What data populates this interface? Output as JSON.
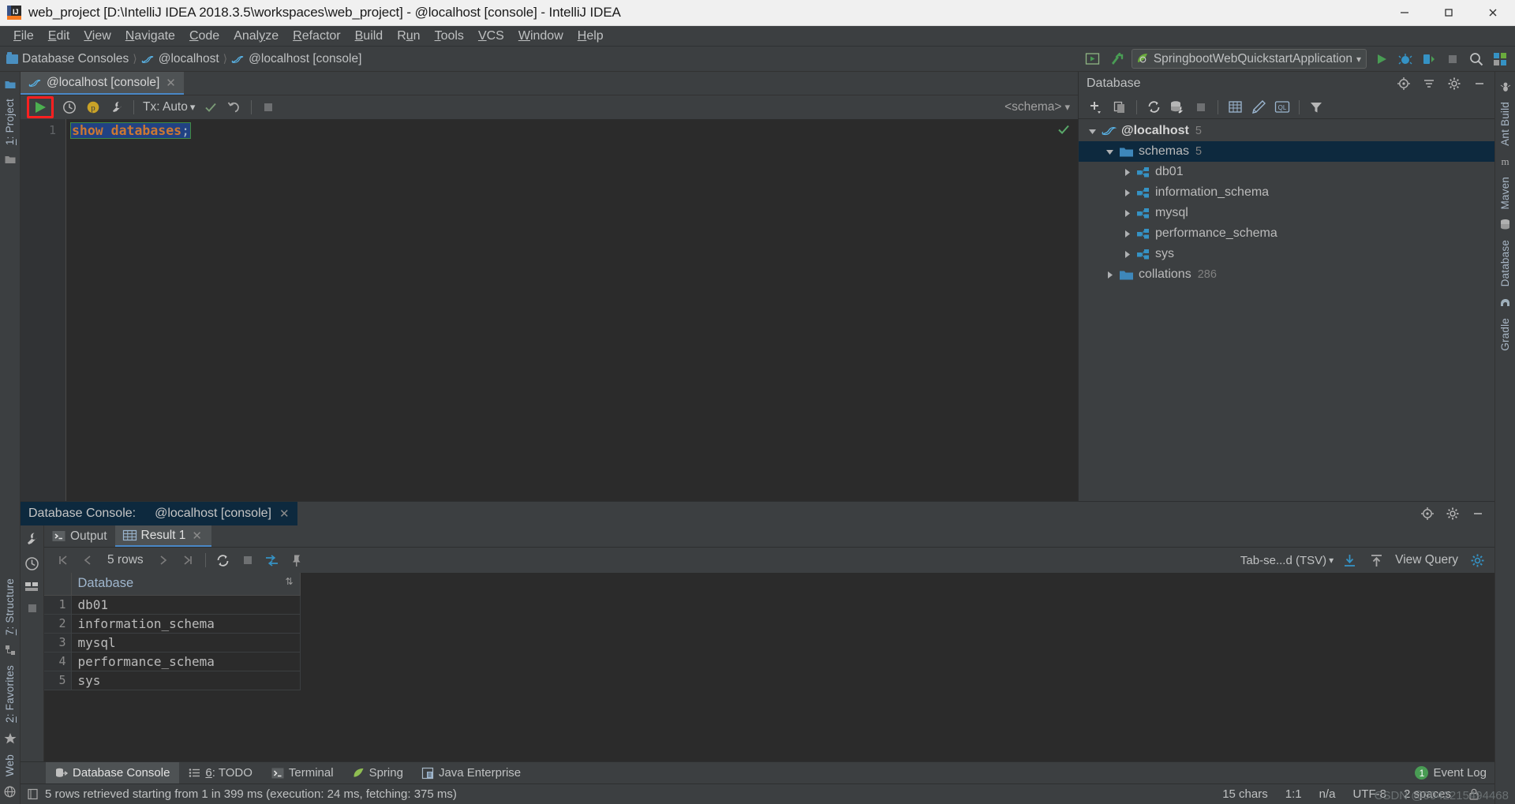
{
  "window": {
    "title": "web_project [D:\\IntelliJ IDEA 2018.3.5\\workspaces\\web_project] - @localhost [console] - IntelliJ IDEA",
    "app_icon": "intellij-idea-icon",
    "minimize_glyph": "—",
    "maximize_glyph": "❐",
    "close_glyph": "✕"
  },
  "menubar": {
    "items": [
      {
        "label": "File",
        "mnemonic": "F"
      },
      {
        "label": "Edit",
        "mnemonic": "E"
      },
      {
        "label": "View",
        "mnemonic": "V"
      },
      {
        "label": "Navigate",
        "mnemonic": "N"
      },
      {
        "label": "Code",
        "mnemonic": "C"
      },
      {
        "label": "Analyze",
        "mnemonic": "y"
      },
      {
        "label": "Refactor",
        "mnemonic": "R"
      },
      {
        "label": "Build",
        "mnemonic": "B"
      },
      {
        "label": "Run",
        "mnemonic": "u"
      },
      {
        "label": "Tools",
        "mnemonic": "T"
      },
      {
        "label": "VCS",
        "mnemonic": "V"
      },
      {
        "label": "Window",
        "mnemonic": "W"
      },
      {
        "label": "Help",
        "mnemonic": "H"
      }
    ]
  },
  "navbar": {
    "breadcrumb": [
      {
        "label": "Database Consoles",
        "icon": "folder-icon"
      },
      {
        "label": "@localhost",
        "icon": "mysql-dolphin-icon"
      },
      {
        "label": "@localhost [console]",
        "icon": "mysql-dolphin-icon"
      }
    ],
    "separator": "〉",
    "run_config": {
      "label": "SpringbootWebQuickstartApplication",
      "icon": "spring-boot-icon",
      "chevron": "▾"
    },
    "buttons": [
      {
        "name": "select-run-configuration-icon"
      },
      {
        "name": "build-hammer-icon"
      },
      {
        "name": "run-icon"
      },
      {
        "name": "debug-icon"
      },
      {
        "name": "run-with-coverage-icon"
      },
      {
        "name": "stop-icon"
      },
      {
        "name": "search-everywhere-icon"
      },
      {
        "name": "settings-icon"
      }
    ]
  },
  "left_strip": {
    "items": [
      {
        "label": "1: Project",
        "mnemonic": "1"
      },
      {
        "label": "7: Structure",
        "mnemonic": "7"
      },
      {
        "label": "2: Favorites",
        "mnemonic": "2"
      },
      {
        "label": "Web"
      }
    ],
    "icons": [
      "folder-icon",
      "structure-icon",
      "star-icon",
      "web-globe-icon"
    ]
  },
  "right_strip": {
    "items": [
      {
        "label": "Ant Build",
        "icon": "ant-icon"
      },
      {
        "label": "Maven",
        "icon": "maven-m-icon"
      },
      {
        "label": "Database",
        "icon": "database-icon"
      },
      {
        "label": "Gradle",
        "icon": "gradle-elephant-icon"
      }
    ]
  },
  "editor": {
    "tab": {
      "label": "@localhost [console]",
      "icon": "mysql-dolphin-icon",
      "close": "✕"
    },
    "toolbar": {
      "run_button": {
        "name": "execute-statement-button",
        "highlighted": true,
        "highlight_color": "#ff2020"
      },
      "buttons": [
        {
          "name": "execution-history-icon"
        },
        {
          "name": "parameters-icon",
          "label": "p"
        },
        {
          "name": "data-source-properties-icon"
        },
        {
          "name": "commit-icon"
        },
        {
          "name": "rollback-icon"
        },
        {
          "name": "stop-icon"
        }
      ],
      "tx_label": "Tx: Auto",
      "tx_chevron": "⌄",
      "schema_label": "<schema>",
      "schema_chevron": "⌄"
    },
    "gutter_lines": [
      "1"
    ],
    "sql": {
      "keyword": "show databases",
      "terminator": ";",
      "full_text": "show databases;",
      "selected": true,
      "selection_bg": "#214283",
      "selection_border": "#418b41"
    },
    "inspection_status": "ok-check-icon"
  },
  "database_panel": {
    "title": "Database",
    "header_buttons": [
      {
        "name": "locate-in-tree-icon"
      },
      {
        "name": "collapse-all-icon"
      },
      {
        "name": "settings-gear-icon"
      },
      {
        "name": "hide-panel-icon"
      }
    ],
    "toolbar_buttons": [
      {
        "name": "add-datasource-icon"
      },
      {
        "name": "duplicate-icon"
      },
      {
        "name": "synchronize-icon"
      },
      {
        "name": "datasource-properties-icon"
      },
      {
        "name": "stop-icon"
      },
      {
        "name": "jump-to-console-icon"
      },
      {
        "name": "modify-icon"
      },
      {
        "name": "ql-icon"
      },
      {
        "name": "filter-icon"
      }
    ],
    "tree": [
      {
        "label": "@localhost",
        "count": "5",
        "icon": "mysql-dolphin-icon",
        "depth": 0,
        "expanded": true,
        "bold": true,
        "selected": false
      },
      {
        "label": "schemas",
        "count": "5",
        "icon": "folder-icon",
        "depth": 1,
        "expanded": true,
        "bold": false,
        "selected": true
      },
      {
        "label": "db01",
        "count": "",
        "icon": "schema-icon",
        "depth": 2,
        "expanded": false,
        "bold": false,
        "selected": false
      },
      {
        "label": "information_schema",
        "count": "",
        "icon": "schema-icon",
        "depth": 2,
        "expanded": false,
        "bold": false,
        "selected": false
      },
      {
        "label": "mysql",
        "count": "",
        "icon": "schema-icon",
        "depth": 2,
        "expanded": false,
        "bold": false,
        "selected": false
      },
      {
        "label": "performance_schema",
        "count": "",
        "icon": "schema-icon",
        "depth": 2,
        "expanded": false,
        "bold": false,
        "selected": false
      },
      {
        "label": "sys",
        "count": "",
        "icon": "schema-icon",
        "depth": 2,
        "expanded": false,
        "bold": false,
        "selected": false
      },
      {
        "label": "collations",
        "count": "286",
        "icon": "folder-icon",
        "depth": 1,
        "expanded": false,
        "bold": false,
        "selected": false
      }
    ]
  },
  "console_panel": {
    "title": "Database Console:",
    "session_tab": {
      "label": "@localhost [console]",
      "close": "✕"
    },
    "header_buttons": [
      {
        "name": "locate-in-tree-icon"
      },
      {
        "name": "settings-gear-icon"
      },
      {
        "name": "hide-panel-icon"
      }
    ],
    "side_icons": [
      {
        "name": "wrench-icon"
      },
      {
        "name": "history-clock-icon"
      },
      {
        "name": "table-icon"
      },
      {
        "name": "stop-square-icon"
      }
    ],
    "tabs": [
      {
        "label": "Output",
        "icon": "console-output-icon",
        "active": false,
        "closable": false
      },
      {
        "label": "Result 1",
        "icon": "table-grid-icon",
        "active": true,
        "closable": true,
        "close": "✕"
      }
    ],
    "grid_toolbar": {
      "first_page": "⏮",
      "prev_page": "‹",
      "rows_label": "5 rows",
      "next_page": "›",
      "last_page": "⏭",
      "reload_icon": "reload-page-icon",
      "cancel_icon": "stop-square-icon",
      "transpose_icon": "compare-icon",
      "pin_icon": "pin-tab-icon",
      "format_label": "Tab-se...d (TSV)",
      "format_chevron": "⌄",
      "download_icon": "dump-data-icon",
      "upload_icon": "upload-icon",
      "view_query_label": "View Query",
      "settings_icon": "settings-gear-icon"
    },
    "result_grid": {
      "columns": [
        "Database"
      ],
      "sort_glyph": "⇅",
      "rows": [
        {
          "num": "1",
          "values": [
            "db01"
          ]
        },
        {
          "num": "2",
          "values": [
            "information_schema"
          ]
        },
        {
          "num": "3",
          "values": [
            "mysql"
          ]
        },
        {
          "num": "4",
          "values": [
            "performance_schema"
          ]
        },
        {
          "num": "5",
          "values": [
            "sys"
          ]
        }
      ]
    }
  },
  "bottom_tabs": {
    "items": [
      {
        "label": "Database Console",
        "icon": "database-console-icon",
        "active": true,
        "mnemonic": ""
      },
      {
        "label": "6: TODO",
        "icon": "todo-list-icon",
        "active": false,
        "mnemonic": "6"
      },
      {
        "label": "Terminal",
        "icon": "terminal-icon",
        "active": false,
        "mnemonic": ""
      },
      {
        "label": "Spring",
        "icon": "spring-leaf-icon",
        "active": false,
        "mnemonic": ""
      },
      {
        "label": "Java Enterprise",
        "icon": "java-enterprise-icon",
        "active": false,
        "mnemonic": ""
      }
    ],
    "event_log": {
      "label": "Event Log",
      "badge": "1",
      "badge_color": "#499c54"
    }
  },
  "statusbar": {
    "message_icon": "document-icon",
    "message": "5 rows retrieved starting from 1 in 399 ms (execution: 24 ms, fetching: 375 ms)",
    "cells": [
      "15 chars",
      "1:1",
      "n/a",
      "UTF-8",
      "2 spaces"
    ],
    "lock_icon": "lock-icon"
  },
  "watermark": "CSDN @0042215494468",
  "colors": {
    "accent_blue": "#4a88c7",
    "selection_blue": "#0d293e",
    "editor_bg": "#2b2b2b",
    "panel_bg": "#3c3f41",
    "highlight_red": "#ff2020",
    "green_run": "#499c54",
    "schema_icon_blue": "#3592c4",
    "keyword_orange": "#cc7832"
  }
}
